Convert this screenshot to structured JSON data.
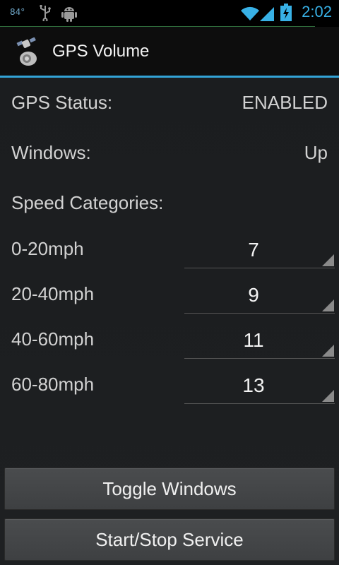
{
  "status_bar": {
    "temperature": "84°",
    "time": "2:02",
    "icons": [
      "usb-icon",
      "android-debug-icon",
      "wifi-icon",
      "signal-icon",
      "battery-charging-icon"
    ]
  },
  "action_bar": {
    "app_icon": "satellite-speaker-icon",
    "title": "GPS Volume"
  },
  "status_section": {
    "gps_label": "GPS Status:",
    "gps_value": "ENABLED",
    "windows_label": "Windows:",
    "windows_value": "Up"
  },
  "speed": {
    "heading": "Speed Categories:",
    "rows": [
      {
        "label": "0-20mph",
        "value": "7"
      },
      {
        "label": "20-40mph",
        "value": "9"
      },
      {
        "label": "40-60mph",
        "value": "11"
      },
      {
        "label": "60-80mph",
        "value": "13"
      }
    ]
  },
  "buttons": {
    "toggle_windows": "Toggle Windows",
    "start_stop": "Start/Stop Service"
  },
  "colors": {
    "accent": "#33a3d6",
    "clock": "#38b1e6",
    "background": "#1a1c1e"
  }
}
